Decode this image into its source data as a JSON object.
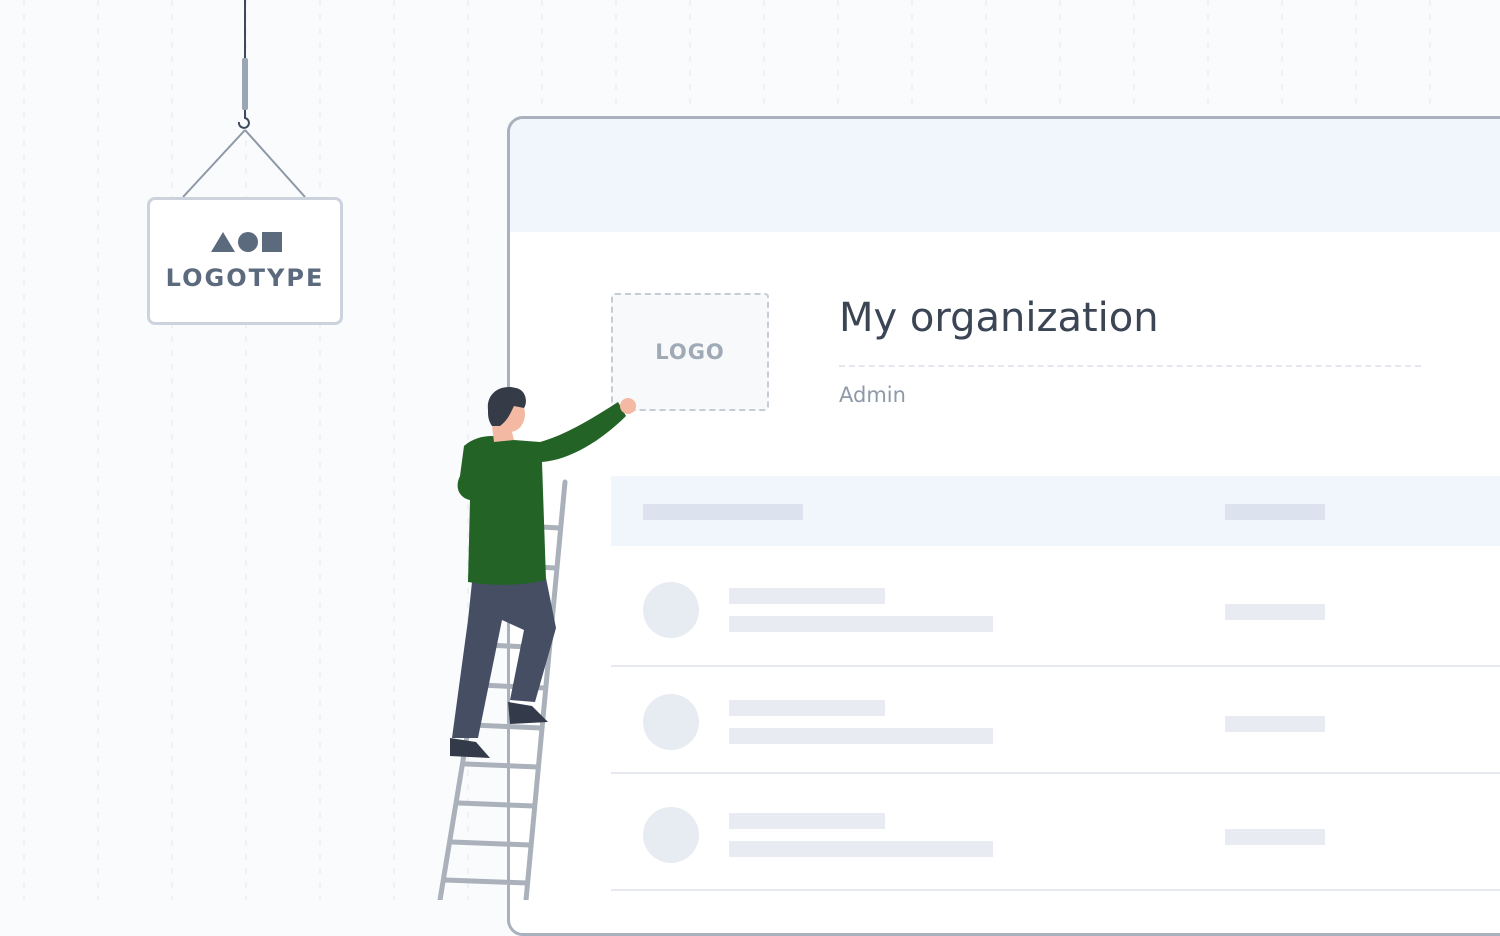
{
  "sign": {
    "logotype_label": "LOGOTYPE",
    "shape_icons": [
      "triangle-icon",
      "circle-icon",
      "square-icon"
    ]
  },
  "profile": {
    "logo_placeholder_label": "LOGO",
    "org_name": "My organization",
    "role": "Admin"
  },
  "table": {
    "row_count": 3
  },
  "colors": {
    "background": "#f9fbfd",
    "window_border": "#a8b1bd",
    "header_fill": "#f1f6fd",
    "skeleton": "#dde3ee",
    "text_dark": "#3b4554",
    "text_muted": "#8e99a8",
    "shirt": "#236325",
    "pants": "#454e62"
  }
}
